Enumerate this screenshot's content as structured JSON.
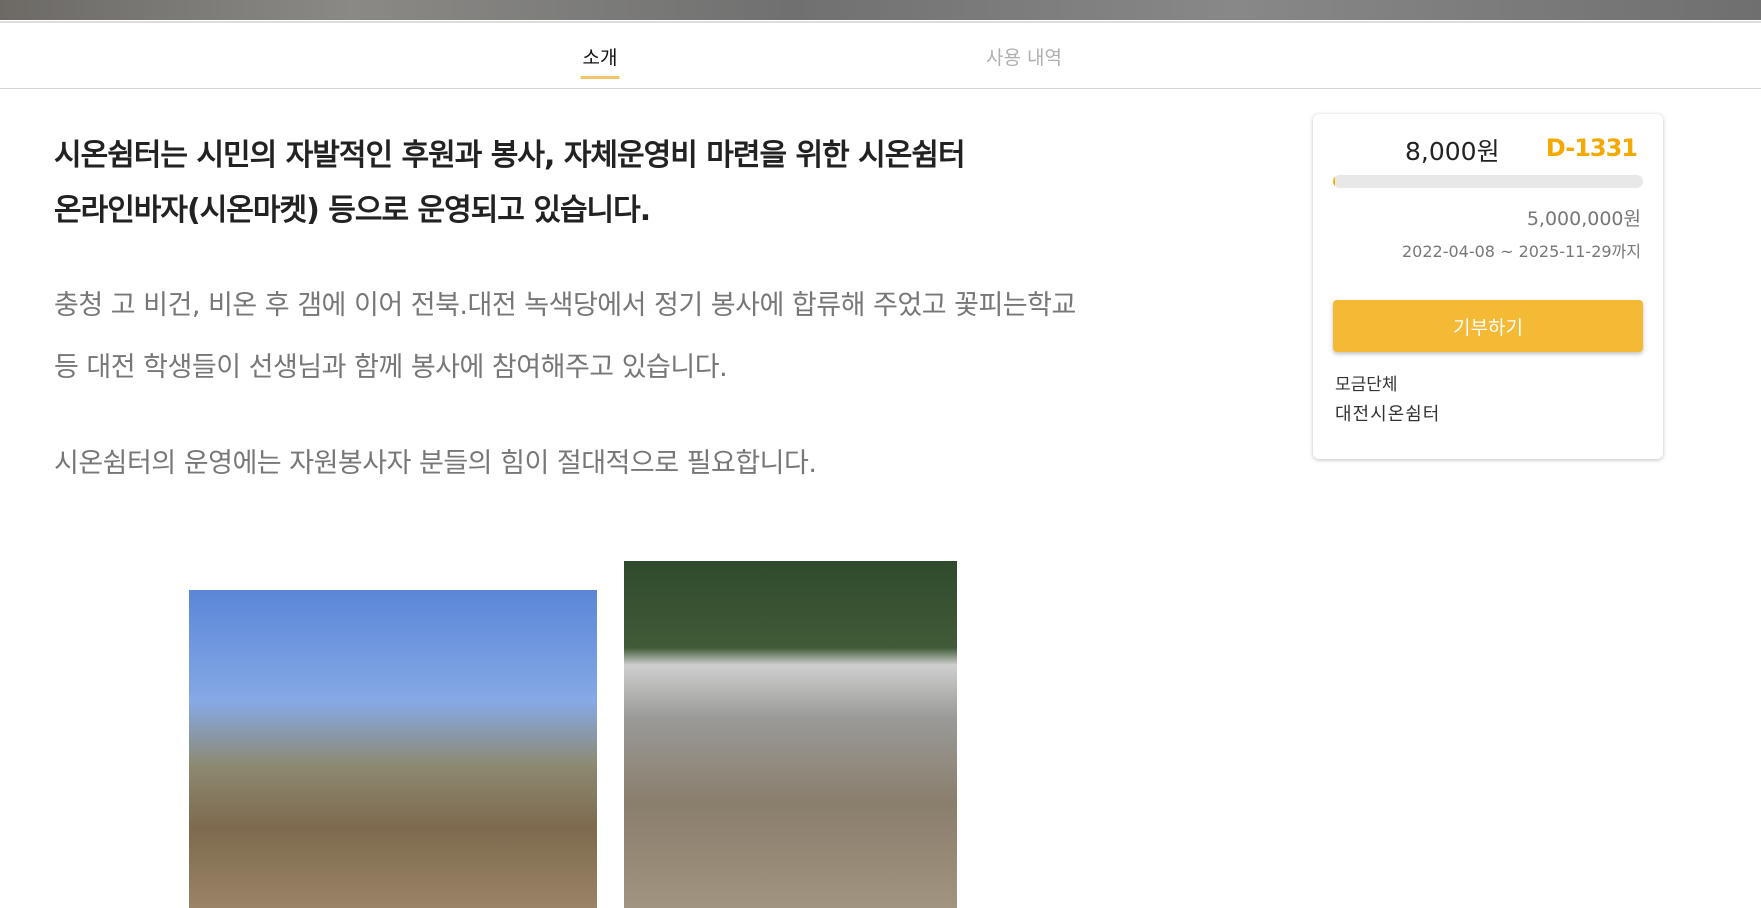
{
  "tabs": [
    {
      "label": "소개",
      "active": true
    },
    {
      "label": "사용 내역",
      "active": false
    }
  ],
  "content": {
    "headline_line1": "시온쉼터는 시민의 자발적인 후원과 봉사, 자체운영비 마련을 위한 시온쉼터",
    "headline_line2": "온라인바자(시온마켓) 등으로 운영되고 있습니다.",
    "para1_line1": "충청 고 비건, 비온 후 갬에 이어 전북.대전 녹색당에서 정기 봉사에 합류해 주었고 꽃피는학교",
    "para1_line2": "등 대전 학생들이 선생님과 함께 봉사에 참여해주고 있습니다.",
    "para2": "시온쉼터의 운영에는 자원봉사자 분들의 힘이 절대적으로 필요합니다."
  },
  "card": {
    "raised": "8,000원",
    "dday": "D-1331",
    "progress_percent": 0.16,
    "goal": "5,000,000원",
    "period": "2022-04-08 ~ 2025-11-29까지",
    "donate_label": "기부하기",
    "org_label": "모금단체",
    "org_name": "대전시온쉼터",
    "accent_color": "#f4b935"
  }
}
